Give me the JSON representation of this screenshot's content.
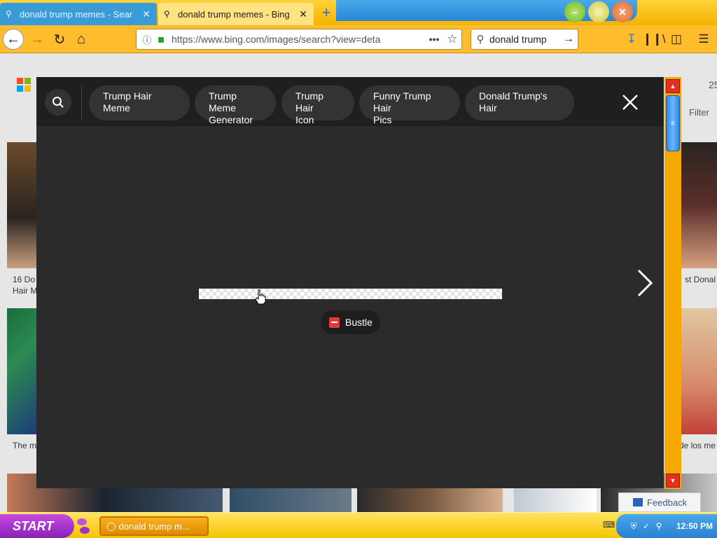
{
  "browser": {
    "tabs": [
      {
        "title": "donald trump memes - Sear",
        "active": false
      },
      {
        "title": "donald trump memes - Bing",
        "active": true
      }
    ],
    "new_tab_icon": "plus-icon",
    "url": "https://www.bing.com/images/search?view=deta",
    "search_text": "donald trump",
    "colors": {
      "chrome": "#ffbd2e",
      "tab_inactive": "#3a9bd9",
      "tab_active": "#ffe380"
    }
  },
  "page": {
    "page_count_fragment": "25",
    "filter_label": "Filter",
    "captions": {
      "left_1a": "16 Do",
      "left_1b": "Hair M",
      "left_2": "The m",
      "right_1": "st Donal",
      "right_2": "de los me"
    },
    "feedback_label": "Feedback"
  },
  "overlay": {
    "chips": [
      {
        "line1": "Trump Hair Meme",
        "line2": ""
      },
      {
        "line1": "Trump Meme",
        "line2": "Generator"
      },
      {
        "line1": "Trump Hair",
        "line2": "Icon"
      },
      {
        "line1": "Funny Trump Hair",
        "line2": "Pics"
      },
      {
        "line1": "Donald Trump's Hair",
        "line2": ""
      }
    ],
    "source_label": "Bustle",
    "colors": {
      "background": "#2b2b2b",
      "header": "#1f1f1f",
      "chip": "#333333"
    }
  },
  "taskbar": {
    "start_label": "START",
    "task_label": "donald trump m...",
    "clock": "12:50 PM"
  }
}
